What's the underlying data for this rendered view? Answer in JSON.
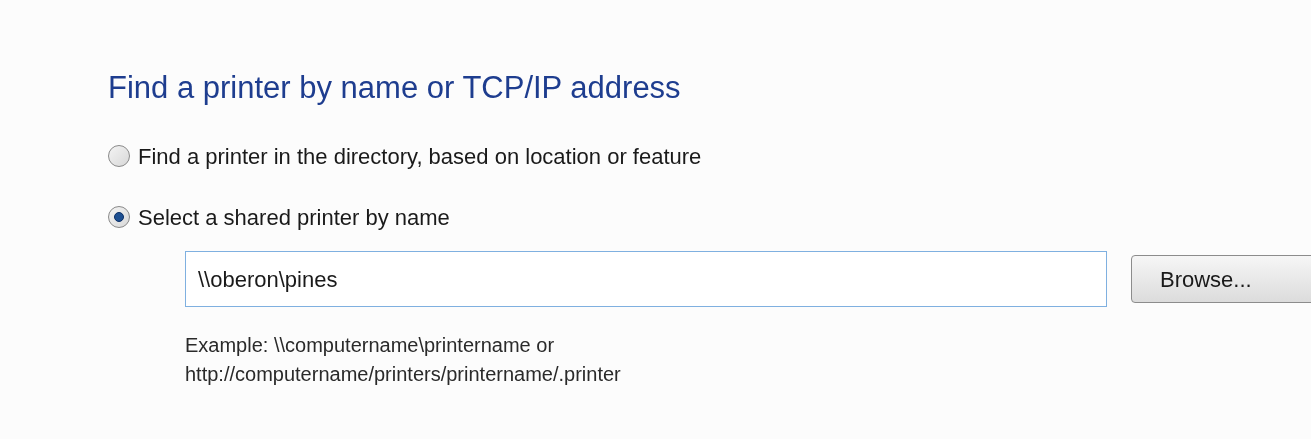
{
  "heading": "Find a printer by name or TCP/IP address",
  "options": [
    {
      "label": "Find a printer in the directory, based on location or feature",
      "selected": false
    },
    {
      "label": "Select a shared printer by name",
      "selected": true
    }
  ],
  "printer_name_field": {
    "value": "\\\\oberon\\pines"
  },
  "browse_button": "Browse...",
  "example_lines": [
    "Example: \\\\computername\\printername or",
    "http://computername/printers/printername/.printer"
  ]
}
